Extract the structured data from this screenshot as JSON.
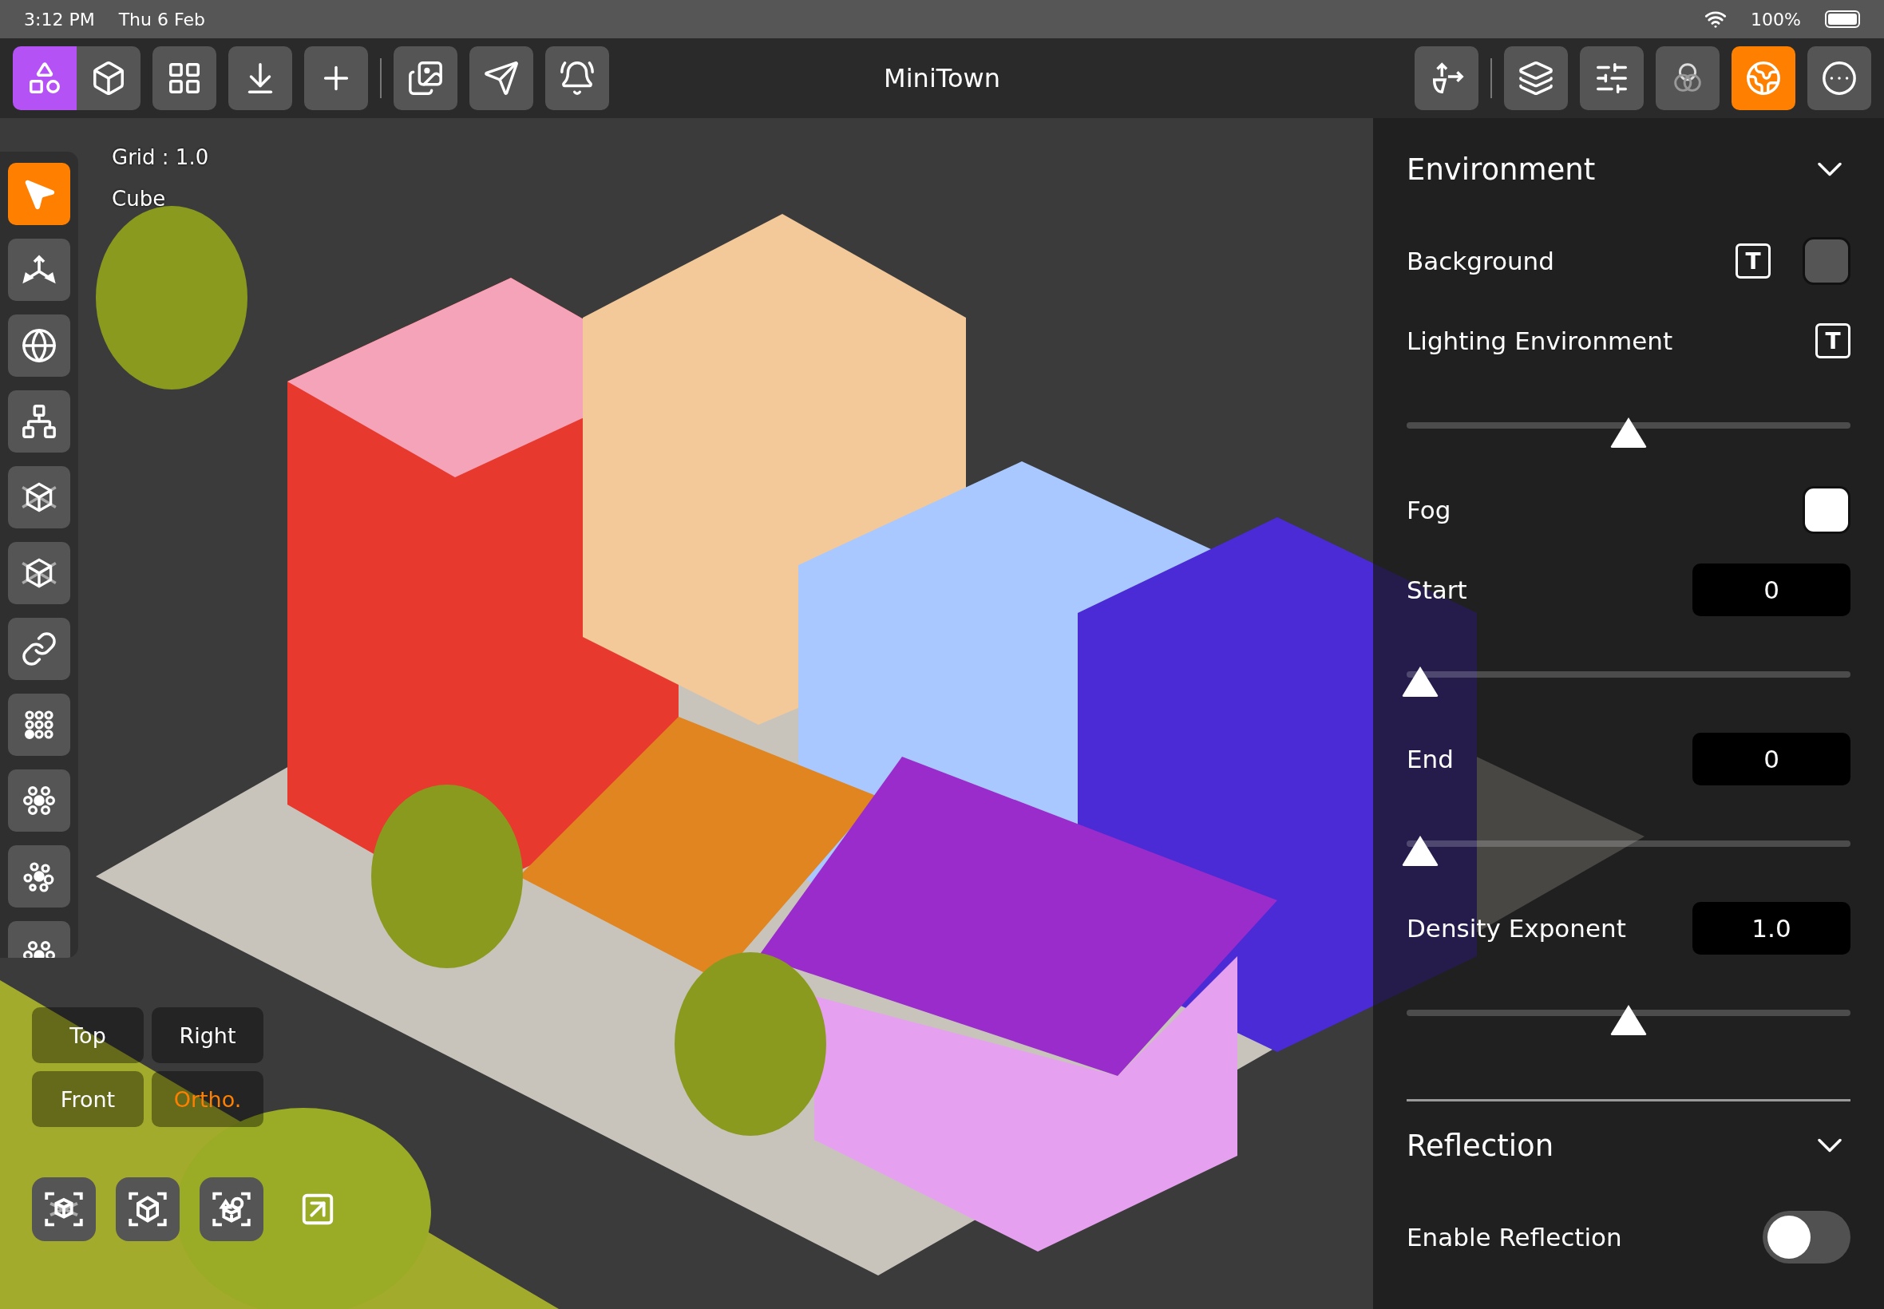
{
  "status_bar": {
    "time": "3:12 PM",
    "date": "Thu 6 Feb",
    "battery": "100%"
  },
  "toolbar": {
    "title": "MiniTown",
    "left_buttons": [
      {
        "selected": true
      },
      {
        "selected": false
      },
      {
        "selected": false
      },
      {
        "selected": false
      },
      {
        "selected": false
      },
      {
        "selected": false
      },
      {
        "selected": false
      },
      {
        "selected": false
      }
    ],
    "right_buttons": [
      {
        "selected": false
      },
      {
        "selected": false
      },
      {
        "selected": false
      },
      {
        "selected": false
      },
      {
        "selected": true
      },
      {
        "selected": false
      }
    ]
  },
  "viewport": {
    "grid_label": "Grid : 1.0",
    "object_label": "Cube",
    "tools": [
      {
        "selected": true
      },
      {
        "selected": false
      },
      {
        "selected": false
      },
      {
        "selected": false
      },
      {
        "selected": false
      },
      {
        "selected": false
      },
      {
        "selected": false
      },
      {
        "selected": false
      },
      {
        "selected": false
      },
      {
        "selected": false
      },
      {
        "selected": false
      }
    ],
    "camera_views": [
      {
        "label": "Top",
        "selected": false
      },
      {
        "label": "Right",
        "selected": false
      },
      {
        "label": "Front",
        "selected": false
      },
      {
        "label": "Ortho.",
        "selected": true
      }
    ]
  },
  "panel": {
    "sections": [
      {
        "title": "Environment",
        "rows": [
          {
            "kind": "texture_color",
            "label": "Background",
            "button": "T",
            "color": "#555555"
          },
          {
            "kind": "texture",
            "label": "Lighting Environment",
            "button": "T"
          },
          {
            "kind": "slider",
            "level": 0.5
          },
          {
            "kind": "color",
            "label": "Fog",
            "color": "#ffffff"
          },
          {
            "kind": "number",
            "label": "Start",
            "value": "0"
          },
          {
            "kind": "slider",
            "level": 0.03
          },
          {
            "kind": "number",
            "label": "End",
            "value": "0"
          },
          {
            "kind": "slider",
            "level": 0.03
          },
          {
            "kind": "number",
            "label": "Density Exponent",
            "value": "1.0"
          },
          {
            "kind": "slider",
            "level": 0.5
          }
        ]
      },
      {
        "title": "Reflection",
        "rows": [
          {
            "kind": "toggle",
            "label": "Enable Reflection",
            "on": false
          }
        ]
      }
    ]
  }
}
